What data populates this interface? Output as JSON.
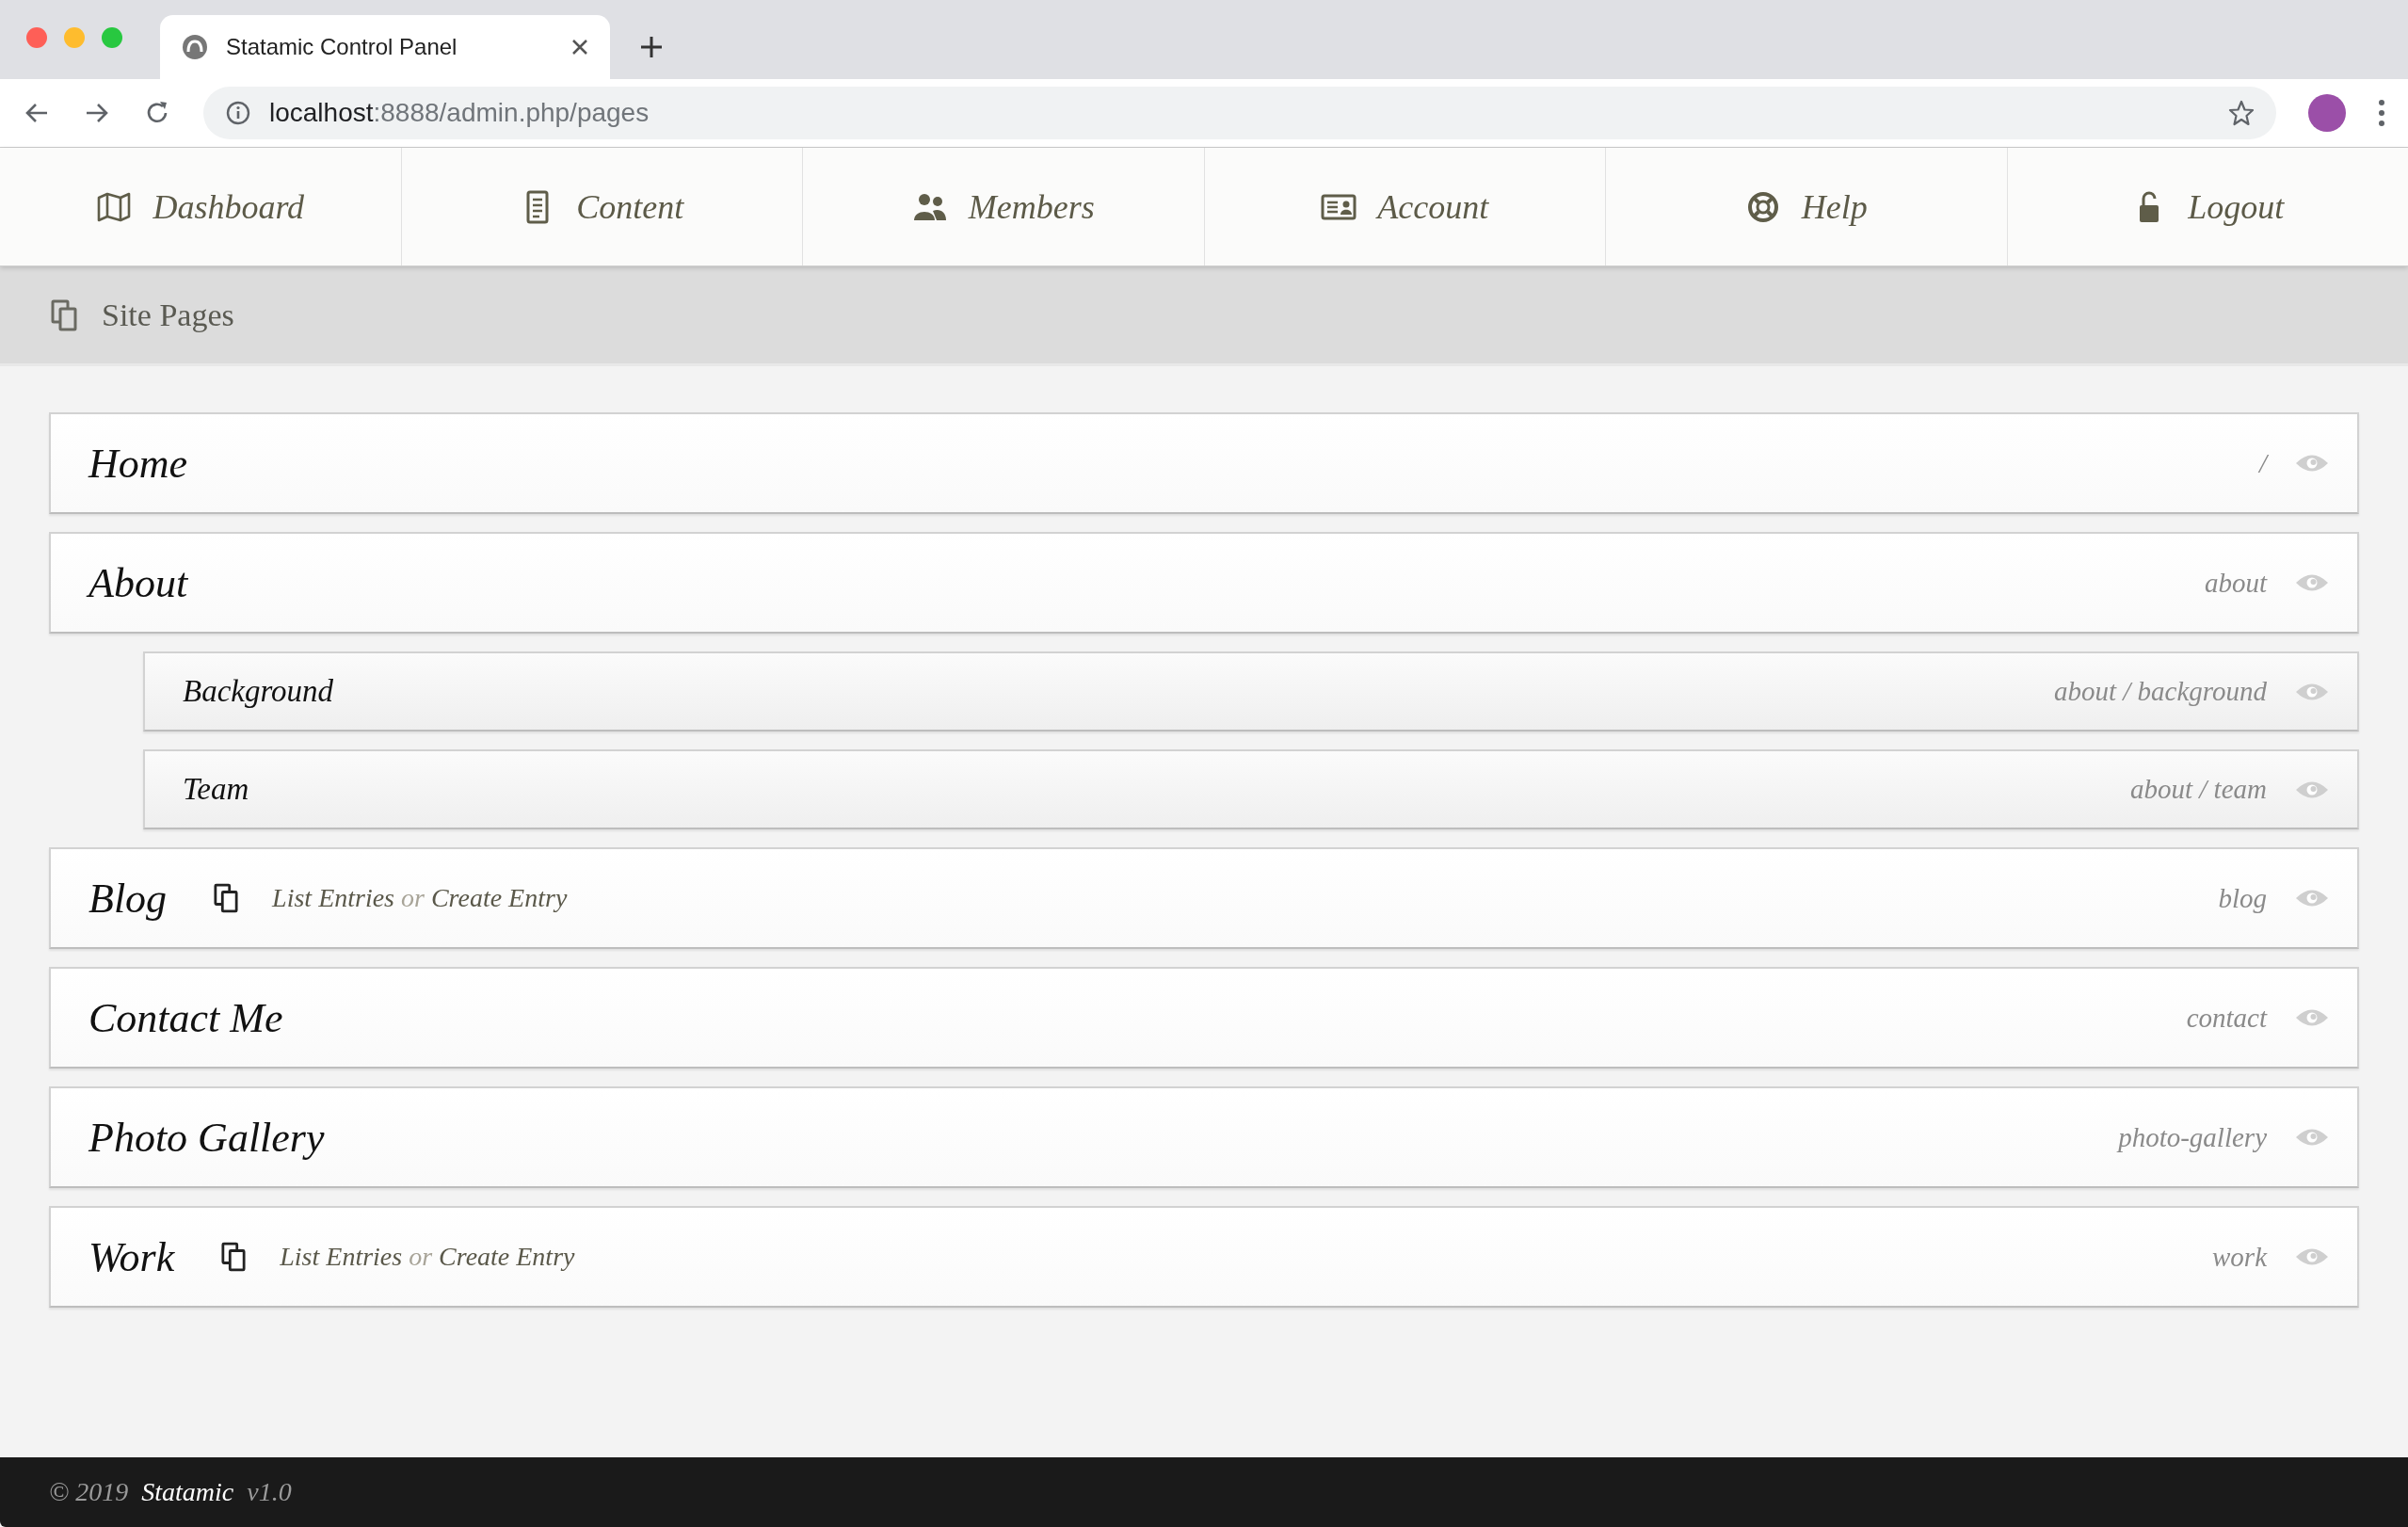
{
  "browser": {
    "tab_title": "Statamic Control Panel",
    "url_host": "localhost",
    "url_rest": ":8888/admin.php/pages"
  },
  "nav": [
    {
      "label": "Dashboard"
    },
    {
      "label": "Content"
    },
    {
      "label": "Members"
    },
    {
      "label": "Account"
    },
    {
      "label": "Help"
    },
    {
      "label": "Logout"
    }
  ],
  "breadcrumb": {
    "label": "Site Pages"
  },
  "pages": [
    {
      "title": "Home",
      "slug": "/"
    },
    {
      "title": "About",
      "slug": "about",
      "children": [
        {
          "title": "Background",
          "slug": "about / background"
        },
        {
          "title": "Team",
          "slug": "about / team"
        }
      ]
    },
    {
      "title": "Blog",
      "slug": "blog",
      "entries": {
        "list": "List Entries",
        "or": "or",
        "create": "Create Entry"
      }
    },
    {
      "title": "Contact Me",
      "slug": "contact"
    },
    {
      "title": "Photo Gallery",
      "slug": "photo-gallery"
    },
    {
      "title": "Work",
      "slug": "work",
      "entries": {
        "list": "List Entries",
        "or": "or",
        "create": "Create Entry"
      }
    }
  ],
  "footer": {
    "copyright": "© 2019",
    "brand": "Statamic",
    "version": "v1.0"
  }
}
